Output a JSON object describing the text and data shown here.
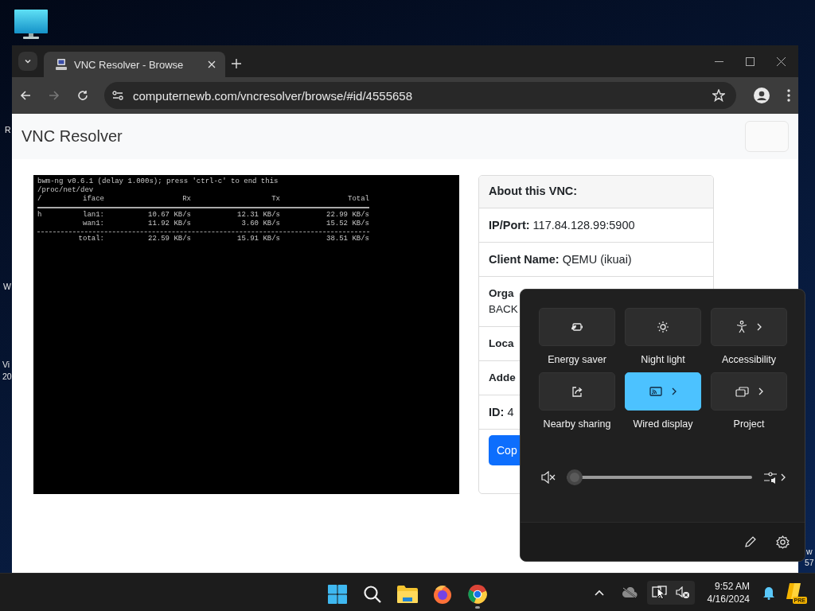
{
  "desktop": {
    "clipped_labels": [
      "R",
      "W",
      "Vi",
      "20",
      "w",
      "57"
    ]
  },
  "browser": {
    "tabs": [
      {
        "title": "VNC Resolver - Browse",
        "selected": true
      }
    ],
    "address": "computernewb.com/vncresolver/browse/#id/4555658"
  },
  "page": {
    "brand": "VNC Resolver",
    "terminal": {
      "lines": [
        "bwm-ng v0.6.1 (delay 1.000s); press 'ctrl-c' to end this",
        "/proc/net/dev"
      ],
      "header": [
        "/",
        "iface",
        "Rx",
        "Tx",
        "Total"
      ],
      "rows": [
        {
          "kind": "item",
          "cells": [
            "h",
            "lan1:",
            "10.67 KB/s",
            "12.31 KB/s",
            "22.99 KB/s"
          ]
        },
        {
          "kind": "item",
          "cells": [
            "",
            "wan1:",
            "11.92 KB/s",
            "3.60 KB/s",
            "15.52 KB/s"
          ]
        },
        {
          "kind": "total",
          "cells": [
            "",
            "total:",
            "22.59 KB/s",
            "15.91 KB/s",
            "38.51 KB/s"
          ]
        }
      ]
    },
    "card": {
      "title": "About this VNC:",
      "rows": [
        {
          "label": "IP/Port:",
          "value": "117.84.128.99:5900"
        },
        {
          "label": "Client Name:",
          "value": "QEMU (ikuai)"
        },
        {
          "label": "Orga",
          "value": "BACK"
        },
        {
          "label": "Loca"
        },
        {
          "label": "Adde"
        },
        {
          "label": "ID:",
          "value": "4"
        }
      ],
      "button": "Cop"
    }
  },
  "quick_settings": {
    "tiles": [
      {
        "label": "Energy saver",
        "kind": "energy",
        "on": false,
        "has_menu": false
      },
      {
        "label": "Night light",
        "kind": "night",
        "on": false,
        "has_menu": false
      },
      {
        "label": "Accessibility",
        "kind": "accessibility",
        "on": false,
        "has_menu": true
      },
      {
        "label": "Nearby sharing",
        "kind": "share",
        "on": false,
        "has_menu": false
      },
      {
        "label": "Wired display",
        "kind": "cast",
        "on": true,
        "has_menu": true
      },
      {
        "label": "Project",
        "kind": "project",
        "on": false,
        "has_menu": true
      }
    ],
    "volume": {
      "muted": true,
      "level": 0
    }
  },
  "taskbar": {
    "apps": [
      {
        "kind": "start",
        "running": false
      },
      {
        "kind": "search",
        "running": false
      },
      {
        "kind": "explorer",
        "running": false
      },
      {
        "kind": "firefox",
        "running": false
      },
      {
        "kind": "chrome",
        "running": true
      }
    ],
    "time": "9:52 AM",
    "date": "4/16/2024",
    "copilot_badge": "PRE"
  }
}
